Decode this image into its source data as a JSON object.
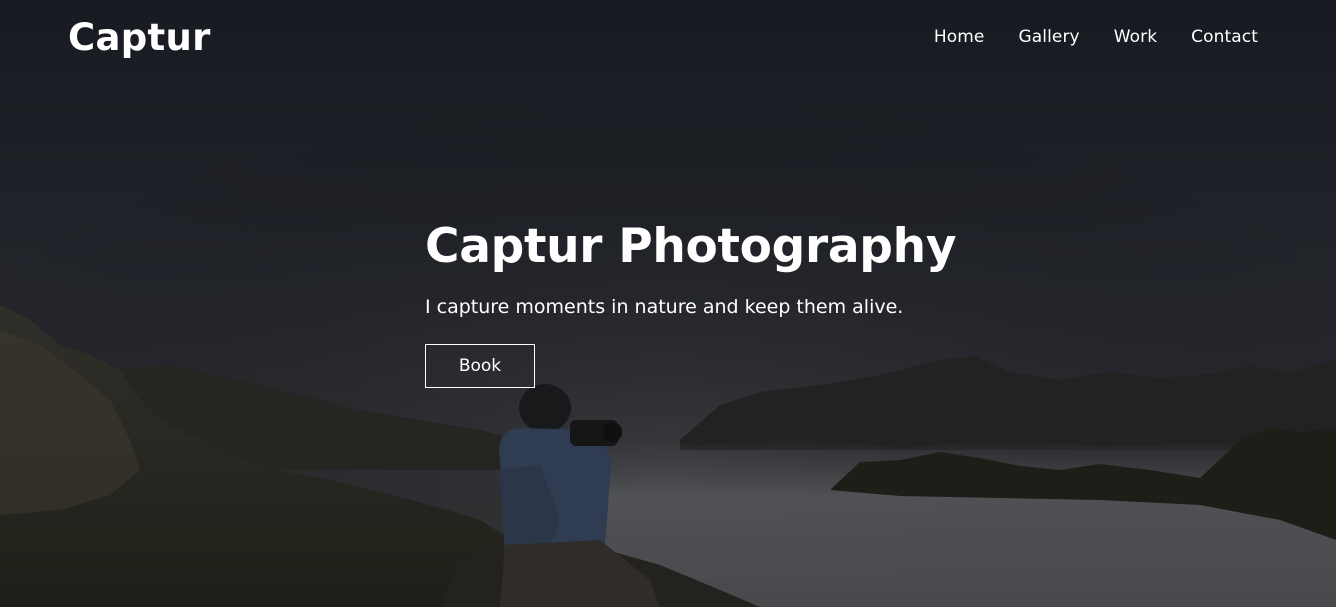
{
  "header": {
    "logo": "Captur",
    "nav": [
      "Home",
      "Gallery",
      "Work",
      "Contact"
    ]
  },
  "hero": {
    "title": "Captur Photography",
    "subtitle": "I capture moments in nature and keep them alive.",
    "cta_label": "Book"
  },
  "colors": {
    "text": "#ffffff",
    "overlay": "#1e2128"
  }
}
